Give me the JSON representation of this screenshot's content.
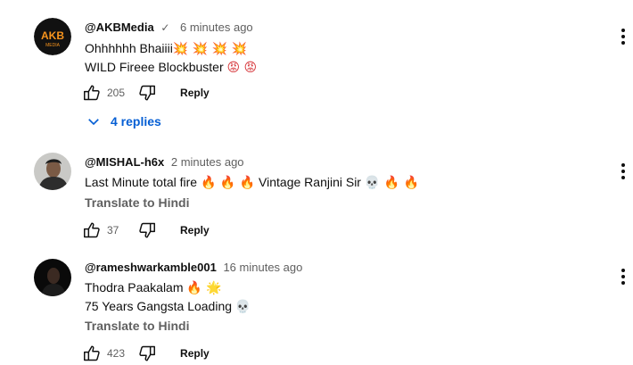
{
  "comments": [
    {
      "author": "@AKBMedia",
      "verified": "✓",
      "time": "6 minutes ago",
      "lines": [
        {
          "text": "Ohhhhhh Bhaiiii",
          "emoji": "💥 💥 💥 💥"
        },
        {
          "text": "WILD Fireee Blockbuster",
          "emoji": "😡 😡"
        }
      ],
      "likes": "205",
      "reply_label": "Reply",
      "replies_label": "4 replies",
      "avatar_text_top": "AKB",
      "avatar_text_bottom": "MEDIA"
    },
    {
      "author": "@MISHAL-h6x",
      "time": "2 minutes ago",
      "line1_a": "Last Minute total fire",
      "line1_a_emoji": "🔥 🔥 🔥",
      "line1_b": "Vintage Ranjini Sir",
      "line1_b_emoji": "💀 🔥 🔥",
      "translate": "Translate to Hindi",
      "likes": "37",
      "reply_label": "Reply"
    },
    {
      "author": "@rameshwarkamble001",
      "time": "16 minutes ago",
      "lines": [
        {
          "text": "Thodra Paakalam",
          "emoji": "🔥 🌟"
        },
        {
          "text": "75 Years Gangsta Loading",
          "emoji": "💀"
        }
      ],
      "translate": "Translate to Hindi",
      "likes": "423",
      "reply_label": "Reply"
    }
  ],
  "colors": {
    "link_blue": "#065fd4",
    "secondary_text": "#606060",
    "primary_text": "#0f0f0f",
    "akb_orange": "#f7941d"
  },
  "icons": [
    "like-icon",
    "dislike-icon",
    "more-vert-icon",
    "chevron-down-icon",
    "verified-check-icon"
  ]
}
